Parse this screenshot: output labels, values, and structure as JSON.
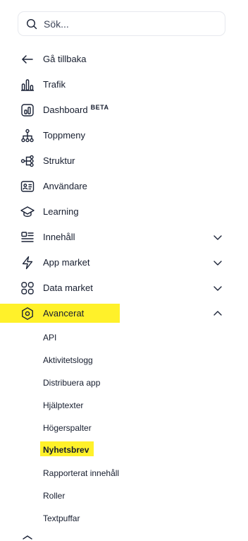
{
  "search": {
    "placeholder": "Sök..."
  },
  "nav": {
    "back": "Gå tillbaka",
    "trafik": "Trafik",
    "dashboard": "Dashboard",
    "dashboard_badge": "BETA",
    "toppmeny": "Toppmeny",
    "struktur": "Struktur",
    "anvandare": "Användare",
    "learning": "Learning",
    "innehall": "Innehåll",
    "app_market": "App market",
    "data_market": "Data market",
    "avancerat": "Avancerat"
  },
  "avancerat_items": [
    "API",
    "Aktivitetslogg",
    "Distribuera app",
    "Hjälptexter",
    "Högerspalter",
    "Nyhetsbrev",
    "Rapporterat innehåll",
    "Roller",
    "Textpuffar"
  ],
  "highlight_color": "#fff12a"
}
